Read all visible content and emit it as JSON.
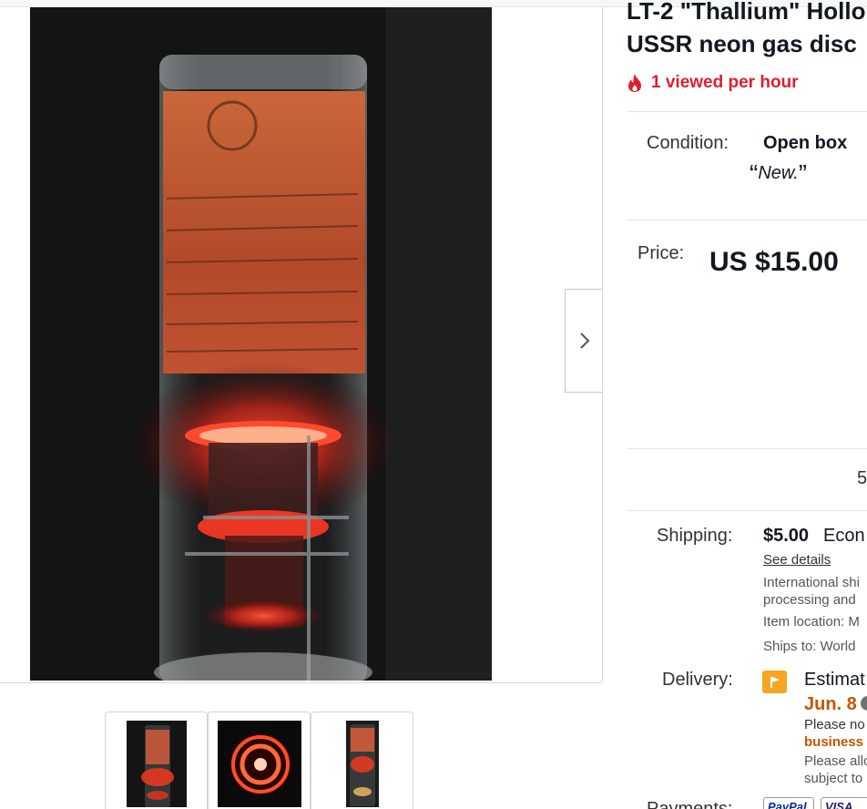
{
  "listing": {
    "title_line1": "LT-2 \"Thallium\" Hollo",
    "title_line2": "USSR neon gas disc",
    "hot_text": "1 viewed per hour"
  },
  "condition": {
    "label": "Condition:",
    "value": "Open box",
    "note": "New."
  },
  "price": {
    "label": "Price:",
    "value": "US $15.00"
  },
  "quantity": {
    "available": "5"
  },
  "shipping": {
    "label": "Shipping:",
    "amount": "$5.00",
    "service": "Econ",
    "see_details": "See details",
    "intl_line1": "International shi",
    "intl_line2": "processing and",
    "location_label": "Item location: M",
    "ships_to": "Ships to:  World"
  },
  "delivery": {
    "label": "Delivery:",
    "estimated": "Estimat",
    "date": "Jun. 8",
    "note_line1": "Please no",
    "business": "business",
    "note_line2": "Please allo",
    "note_line3": "subject to"
  },
  "payments": {
    "label": "Payments:",
    "paypal": "PayPal",
    "visa": "VISA"
  },
  "gallery": {
    "thumbnails": [
      "lamp-side-view",
      "glowing-ring-top-view",
      "lamp-full-view"
    ],
    "selected_index": 0
  },
  "colors": {
    "hot": "#dd1e31",
    "date": "#c45500",
    "flag": "#f5a623",
    "text": "#111820"
  },
  "icons": {
    "fire": "fire-icon",
    "next": "chevron-right-icon",
    "flag": "flag-icon"
  }
}
